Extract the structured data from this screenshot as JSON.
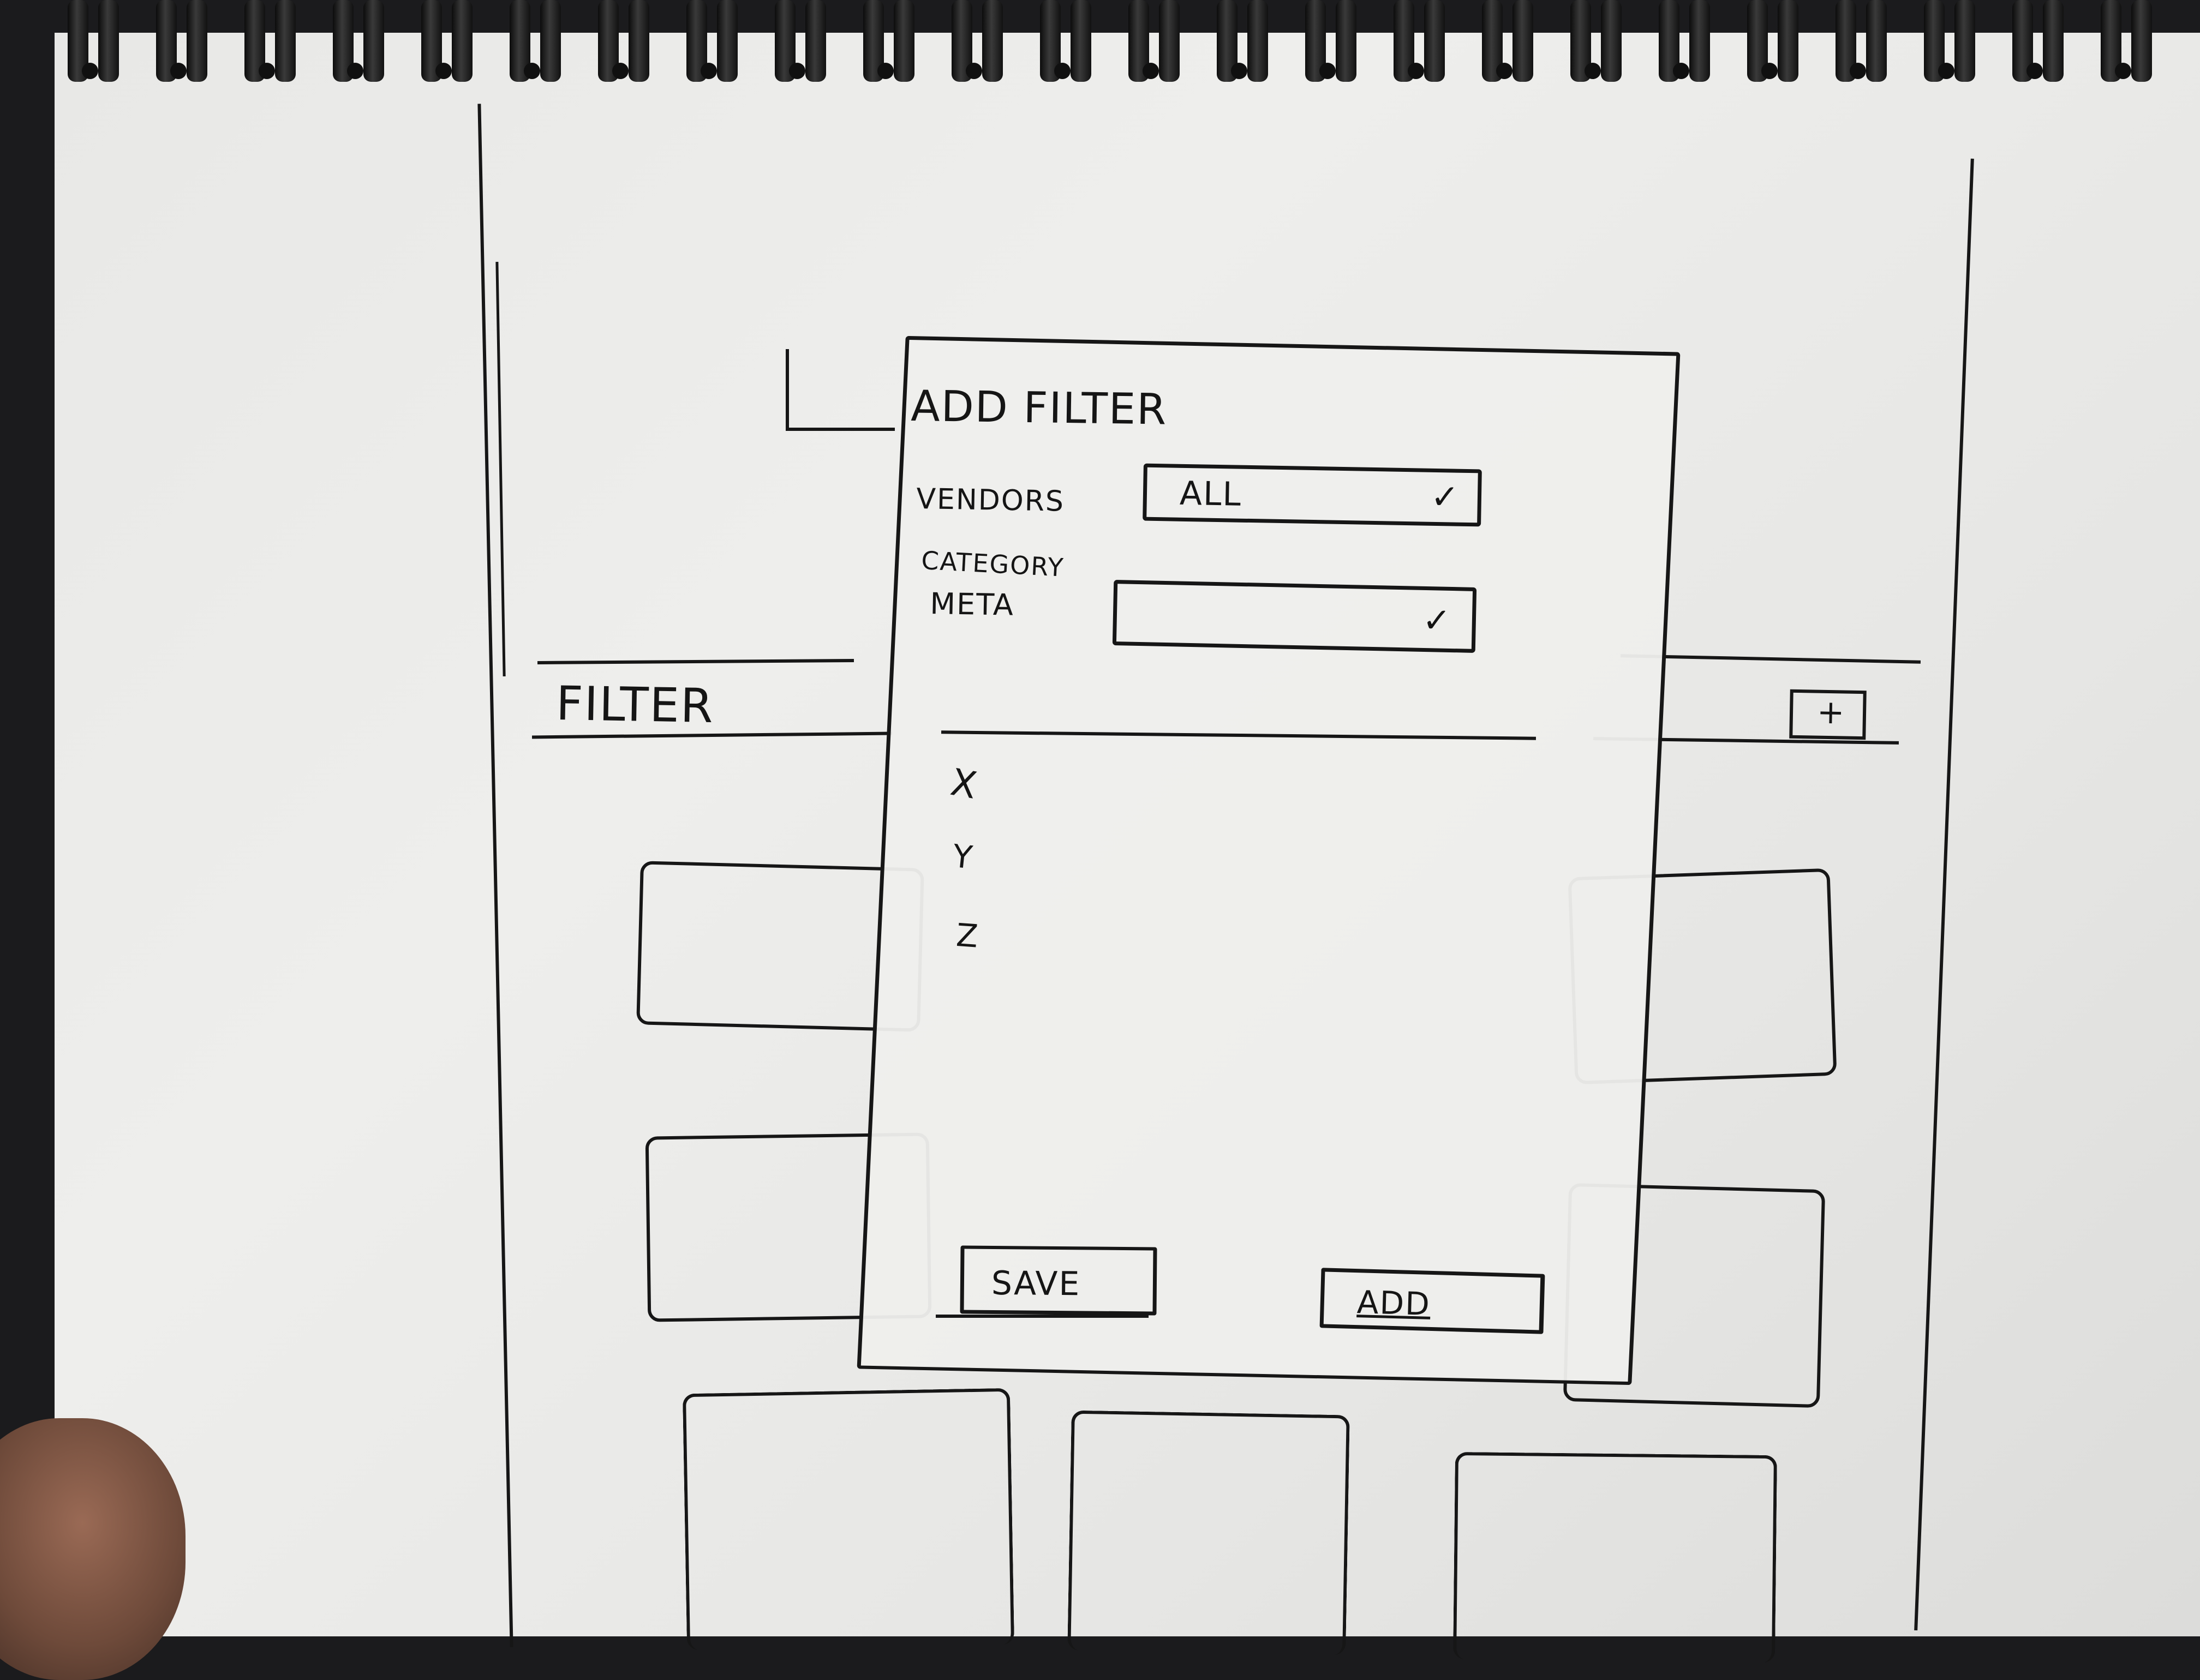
{
  "modal": {
    "title": "ADD FILTER",
    "vendors": {
      "label": "VENDORS",
      "value": "ALL"
    },
    "category_meta": {
      "label_line1": "CATEGORY",
      "label_line2": "META",
      "value": ""
    },
    "options": [
      "X",
      "Y",
      "Z"
    ],
    "save_label": "SAVE",
    "add_label": "ADD"
  },
  "background": {
    "filter_label": "FILTER",
    "add_icon": "plus-icon"
  }
}
